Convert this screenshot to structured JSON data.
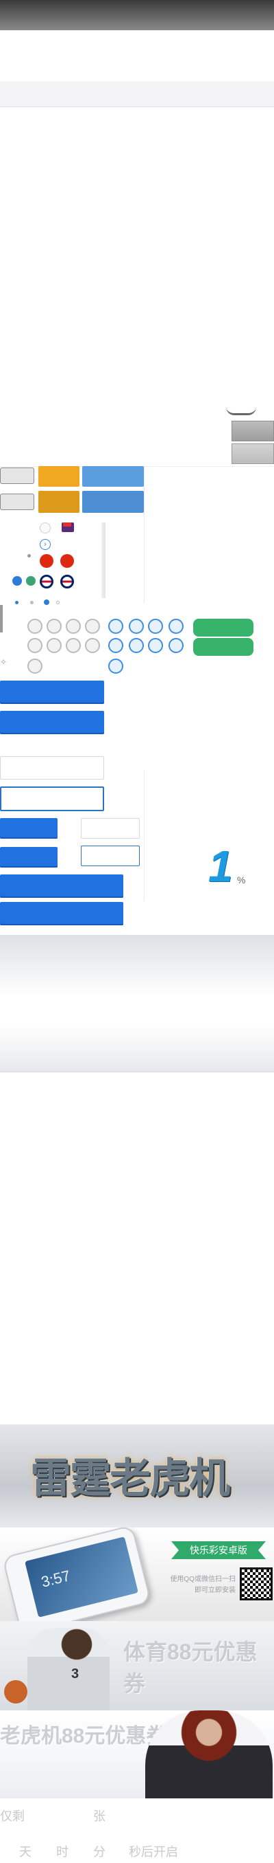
{
  "progress": {
    "value": "1",
    "unit": "%"
  },
  "banners": {
    "slot": {
      "title": "雷霆老虎机"
    },
    "app": {
      "badge": "快乐彩安卓版",
      "hint_line1": "使用QQ或微信扫一扫",
      "hint_line2": "即可立即安装",
      "phone_time": "3:57"
    },
    "sports": {
      "title": "体育88元优惠券",
      "jersey": "3"
    },
    "slot_coupon": {
      "title": "老虎机88元优惠券"
    }
  },
  "footer": {
    "remaining_prefix": "仅剩",
    "remaining_unit": "张",
    "countdown_day": "天",
    "countdown_hour": "时",
    "countdown_min": "分",
    "countdown_suffix": "秒后开启"
  },
  "colors": {
    "orange": "#f0a821",
    "blue": "#5a9ee0",
    "primary_blue": "#1f72e0",
    "green": "#37b36c"
  }
}
